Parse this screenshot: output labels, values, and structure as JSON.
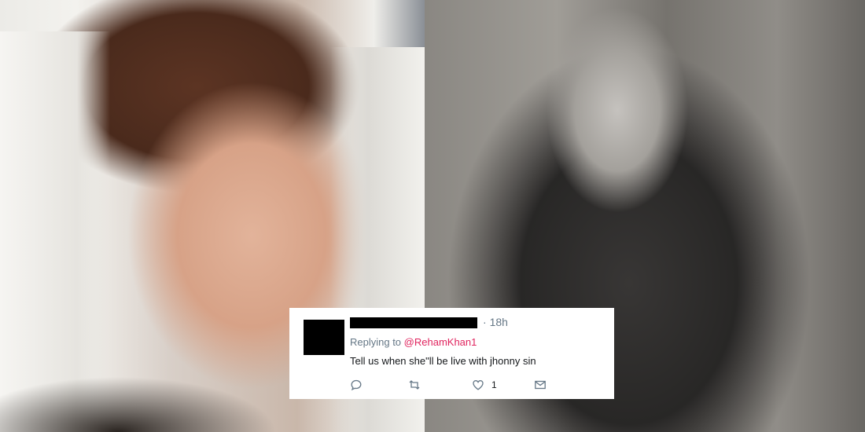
{
  "tweet": {
    "timestamp": "18h",
    "replying_prefix": "Replying to",
    "reply_handle": "@RehamKhan1",
    "text": "Tell us when she\"ll be live with jhonny sin",
    "like_count": "1",
    "icons": [
      "reply-icon",
      "retweet-icon",
      "like-icon",
      "message-icon"
    ]
  },
  "colors": {
    "handle": "#e0245e",
    "muted": "#657786",
    "text": "#14171a"
  }
}
